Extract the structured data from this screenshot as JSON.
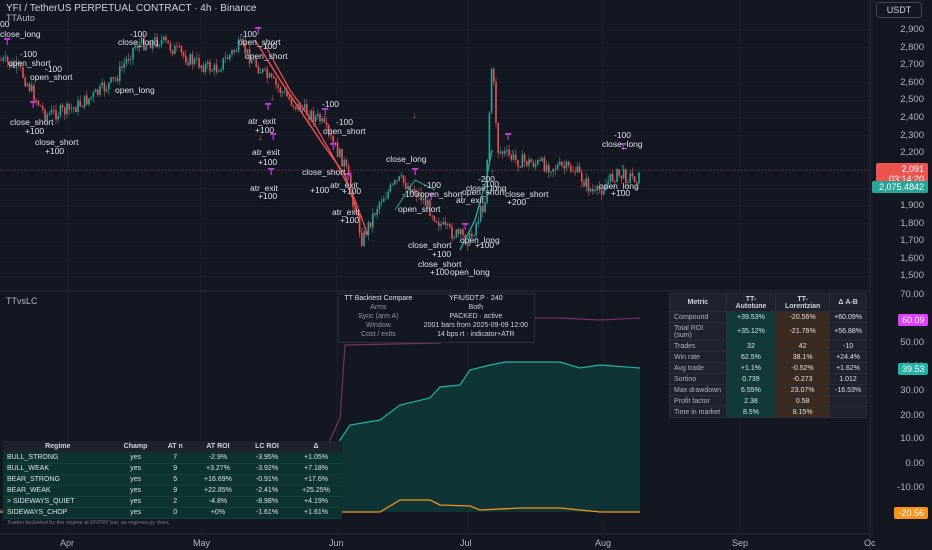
{
  "header": {
    "symbol_title": "YFI / TetherUS PERPETUAL CONTRACT · 4h · Binance",
    "indicator_top": "TTAuto",
    "indicator_bottom": "TTvsLC",
    "currency": "USDT"
  },
  "price_axis": [
    "2,900",
    "2,800",
    "2,700",
    "2,600",
    "2,500",
    "2,400",
    "2,300",
    "2,200",
    "2,100",
    "2,000",
    "1,900",
    "1,800",
    "1,700",
    "1,600",
    "1,500"
  ],
  "price_tags": {
    "current_price": "2,091",
    "countdown": "03:14:20",
    "secondary": "2,075.4842"
  },
  "osc_axis": [
    "70.00",
    "50.00",
    "40.00",
    "30.00",
    "20.00",
    "10.00",
    "0.00",
    "-10.00"
  ],
  "osc_tags": {
    "series_a": "60.09",
    "series_b": "39.53",
    "series_c": "-20.56"
  },
  "time_axis": [
    "Apr",
    "May",
    "Jun",
    "Jul",
    "Aug",
    "Sep",
    "Oc"
  ],
  "signals": [
    {
      "text": "00"
    },
    {
      "text": "close_long"
    },
    {
      "text": "-100"
    },
    {
      "text": "open_short"
    },
    {
      "text": "-100"
    },
    {
      "text": "open_short"
    },
    {
      "text": "close_short"
    },
    {
      "text": "+100"
    },
    {
      "text": "close_short"
    },
    {
      "text": "+100"
    },
    {
      "text": "-100"
    },
    {
      "text": "close_long"
    },
    {
      "text": "open_long"
    },
    {
      "text": "-100"
    },
    {
      "text": "open_short"
    },
    {
      "text": "-100"
    },
    {
      "text": "open_short"
    },
    {
      "text": "atr_exit"
    },
    {
      "text": "+100"
    },
    {
      "text": "atr_exit"
    },
    {
      "text": "+100"
    },
    {
      "text": "atr_exit"
    },
    {
      "text": "+100"
    },
    {
      "text": "-100"
    },
    {
      "text": "open_short"
    },
    {
      "text": "-100"
    },
    {
      "text": "close_long"
    },
    {
      "text": "close_short"
    },
    {
      "text": "+100"
    },
    {
      "text": "atr_exit"
    },
    {
      "text": "+100"
    },
    {
      "text": "atr_exit"
    },
    {
      "text": "+100"
    },
    {
      "text": "-100"
    },
    {
      "text": "open_short"
    },
    {
      "text": "-100"
    },
    {
      "text": "open_short"
    },
    {
      "text": "close_short"
    },
    {
      "text": "+100"
    },
    {
      "text": "close_short"
    },
    {
      "text": "+100"
    },
    {
      "text": "open_long"
    },
    {
      "text": "open_long"
    },
    {
      "text": "-100"
    },
    {
      "text": "open_short"
    },
    {
      "text": "-200"
    },
    {
      "text": "close_long"
    },
    {
      "text": "atr_exit"
    },
    {
      "text": "+100"
    },
    {
      "text": "close_short"
    },
    {
      "text": "+200"
    },
    {
      "text": "-100"
    },
    {
      "text": "close_long"
    },
    {
      "text": "open_long"
    },
    {
      "text": "+100"
    }
  ],
  "compare_panel": {
    "title": "TT Backtest Compare",
    "title_value": "YFIUSDT.P · 240",
    "rows": [
      {
        "key": "Arms",
        "value": "Both"
      },
      {
        "key": "Sync (arm A)",
        "value": "PACKED · active"
      },
      {
        "key": "Window",
        "value": "2001 bars from 2025-09-09 12:00"
      },
      {
        "key": "Cost / exits",
        "value": "14 bps rt · indicator+ATR"
      }
    ]
  },
  "metrics": {
    "headers": [
      "Metric",
      "TT-Autotune",
      "TT-Lorentzian",
      "Δ A-B"
    ],
    "rows": [
      [
        "Compound",
        "+39.53%",
        "-20.56%",
        "+60.09%"
      ],
      [
        "Total ROI (sum)",
        "+35.12%",
        "-21.76%",
        "+56.88%"
      ],
      [
        "Trades",
        "32",
        "42",
        "-10"
      ],
      [
        "Win rate",
        "62.5%",
        "38.1%",
        "+24.4%"
      ],
      [
        "Avg trade",
        "+1.1%",
        "-0.52%",
        "+1.62%"
      ],
      [
        "Sortino",
        "0.739",
        "-0.273",
        "1.012"
      ],
      [
        "Max drawdown",
        "6.55%",
        "23.07%",
        "-16.53%"
      ],
      [
        "Profit factor",
        "2.38",
        "0.58",
        ""
      ],
      [
        "Time in market",
        "8.5%",
        "8.15%",
        ""
      ]
    ]
  },
  "regime": {
    "headers": [
      "Regime",
      "Champ",
      "AT n",
      "AT ROI",
      "LC ROI",
      "Δ"
    ],
    "rows": [
      [
        "BULL_STRONG",
        "yes",
        "7",
        "-2.9%",
        "-3.95%",
        "+1.05%"
      ],
      [
        "BULL_WEAK",
        "yes",
        "9",
        "+3.27%",
        "-3.92%",
        "+7.18%"
      ],
      [
        "BEAR_STRONG",
        "yes",
        "5",
        "+16.69%",
        "-0.91%",
        "+17.6%"
      ],
      [
        "BEAR_WEAK",
        "yes",
        "9",
        "+22.85%",
        "-2.41%",
        "+25.25%"
      ],
      [
        "> SIDEWAYS_QUIET",
        "yes",
        "2",
        "-4.8%",
        "-8.98%",
        "+4.19%"
      ],
      [
        "SIDEWAYS_CHOP",
        "yes",
        "0",
        "+0%",
        "-1.61%",
        "+1.61%"
      ]
    ],
    "footnote": "Trades bucketed by the regime at ENTRY bar, as regimes.py does."
  },
  "colors": {
    "bg": "#131722",
    "up": "#26a69a",
    "down": "#ef5350",
    "teal": "#21b3a4",
    "purple": "#7b2d5f",
    "orange": "#f7931a",
    "magenta": "#e040fb"
  }
}
